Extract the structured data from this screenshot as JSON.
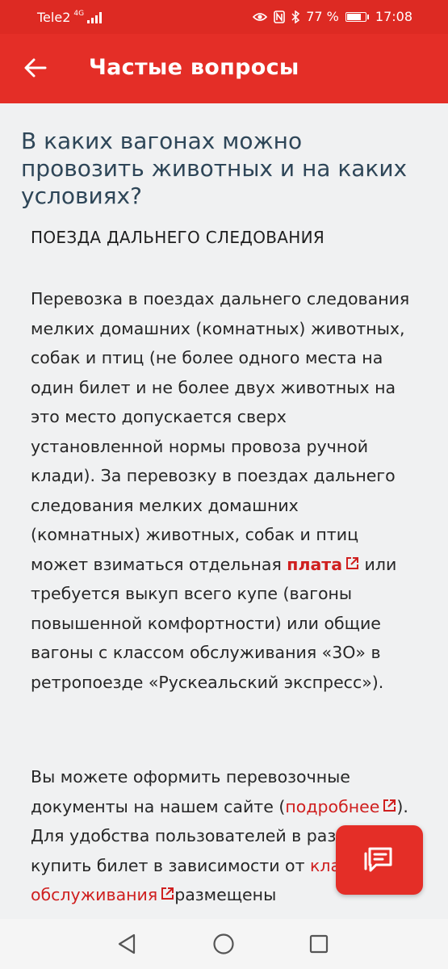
{
  "status_bar": {
    "carrier": "Tele2",
    "network": "4G",
    "battery": "77 %",
    "time": "17:08",
    "icons": [
      "signal-icon",
      "eye-icon",
      "nfc-icon",
      "bluetooth-icon",
      "battery-icon"
    ]
  },
  "app_bar": {
    "back_icon": "arrow-left-icon",
    "title": "Частые вопросы"
  },
  "content": {
    "question": "В каких вагонах можно провозить животных и на каких условиях?",
    "section_heading": "ПОЕЗДА ДАЛЬНЕГО СЛЕДОВАНИЯ",
    "paragraph1": {
      "text_before": "Перевозка в поездах дальнего следования мелких домашних (комнатных) животных, собак и птиц (не более одного места на один билет и не более двух животных на это место допускается сверх установленной нормы провоза ручной клади). За перевозку в поездах дальнего следования мелких домашних (комнатных) животных, собак и птиц может взиматься отдельная ",
      "link": "плата",
      "text_after": " или требуется выкуп всего купе (вагоны повышенной комфортности) или общие вагоны с классом обслуживания «3О» в ретропоезде «Рускеальский экспресс»)."
    },
    "paragraph2": {
      "text1": "Вы можете оформить перевозочные документы на нашем сайте (",
      "link1": "подробнее",
      "text2": "). Для удобства пользователей в разделе купить билет в зависимости от ",
      "link2": "класса обслуживания",
      "text3": "размещены"
    }
  },
  "fab": {
    "icon": "chat-icon"
  },
  "nav_bar": {
    "icons": [
      "back-triangle-icon",
      "home-circle-icon",
      "recents-square-icon"
    ]
  },
  "colors": {
    "accent": "#e42e27",
    "status_bar": "#dd2a23",
    "link": "#cf1f1f",
    "question_text": "#2e4658",
    "background": "#f0f1f2"
  }
}
